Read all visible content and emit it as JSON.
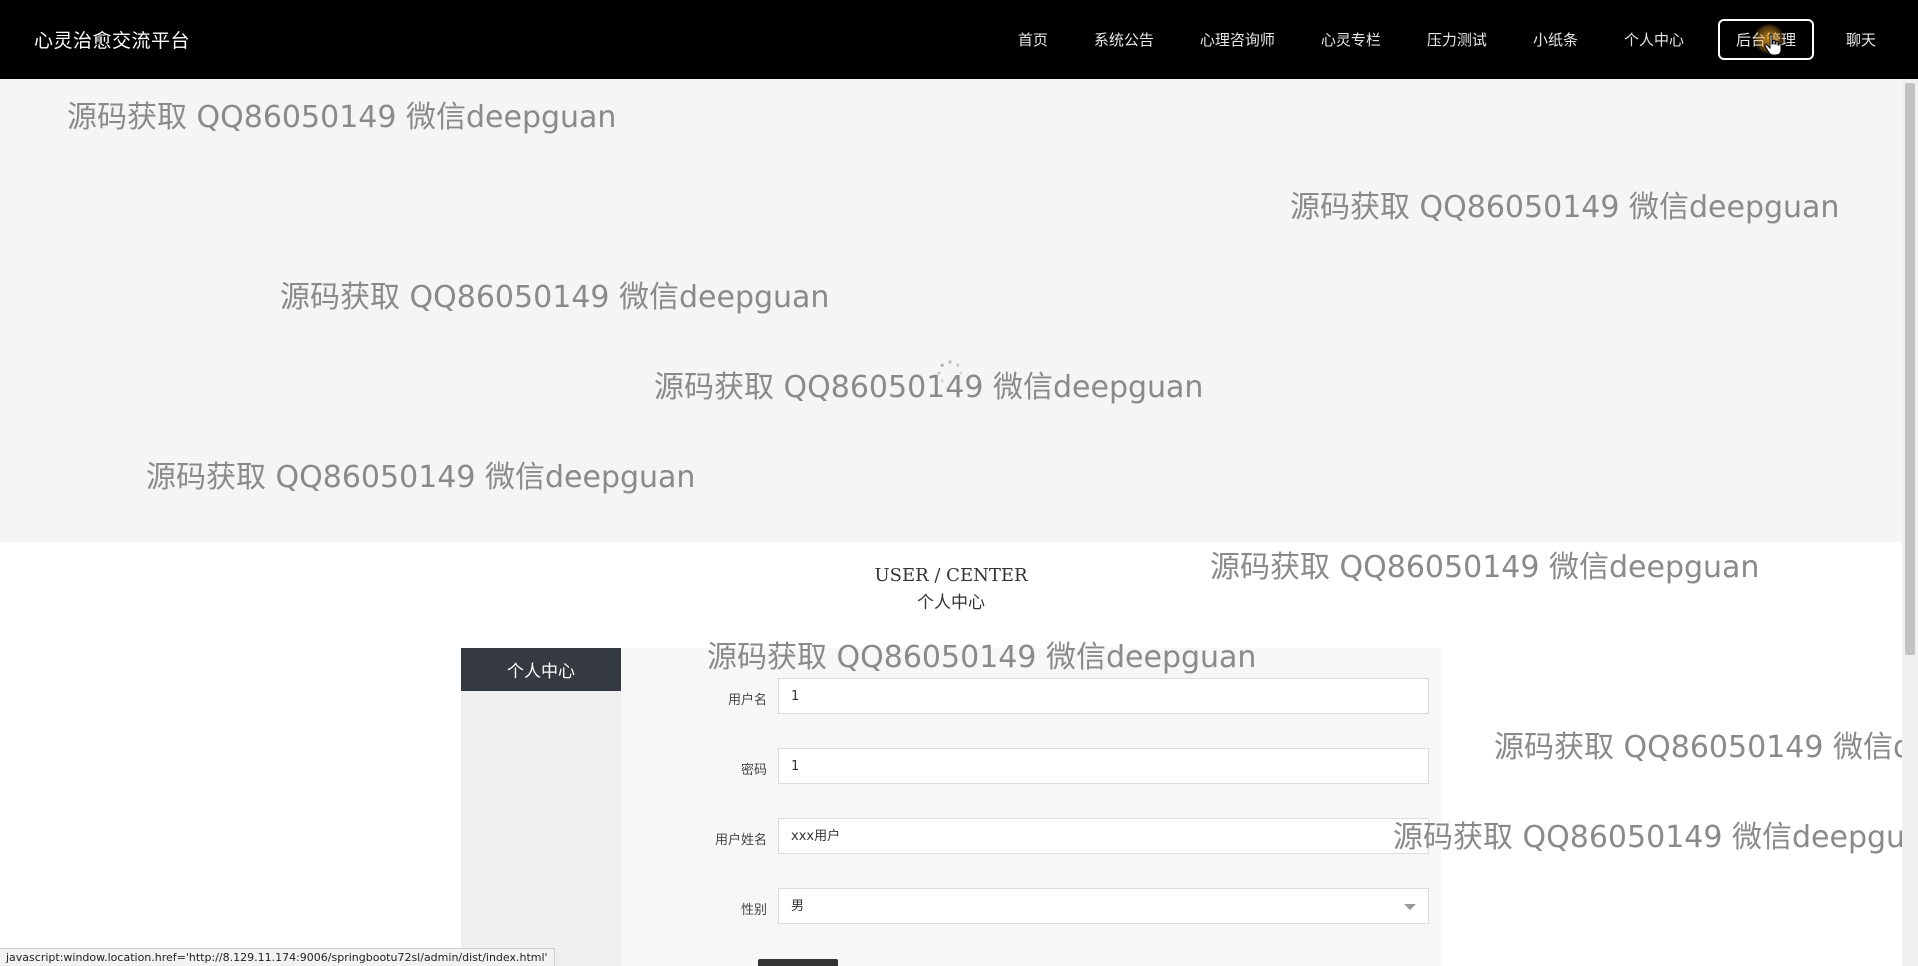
{
  "header": {
    "brand": "心灵治愈交流平台",
    "nav": [
      {
        "label": "首页"
      },
      {
        "label": "系统公告"
      },
      {
        "label": "心理咨询师"
      },
      {
        "label": "心灵专栏"
      },
      {
        "label": "压力测试"
      },
      {
        "label": "小纸条"
      },
      {
        "label": "个人中心"
      },
      {
        "label": "后台管理",
        "active": true
      },
      {
        "label": "聊天"
      }
    ]
  },
  "watermark": {
    "text": "源码获取 QQ86050149 微信deepguan"
  },
  "section": {
    "title_en": "USER / CENTER",
    "title_cn": "个人中心"
  },
  "side_menu": {
    "header": "个人中心"
  },
  "form": {
    "fields": [
      {
        "label": "用户名",
        "value": "1"
      },
      {
        "label": "密码",
        "value": "1"
      },
      {
        "label": "用户姓名",
        "value": "xxx用户"
      },
      {
        "label": "性别",
        "value": "男"
      }
    ]
  },
  "status_bar": {
    "text": "javascript:window.location.href='http://8.129.11.174:9006/springbootu72sl/admin/dist/index.html'"
  },
  "colors": {
    "navbar": "#000000",
    "banner": "#f5f5f5",
    "side_menu_header": "#343a40"
  }
}
